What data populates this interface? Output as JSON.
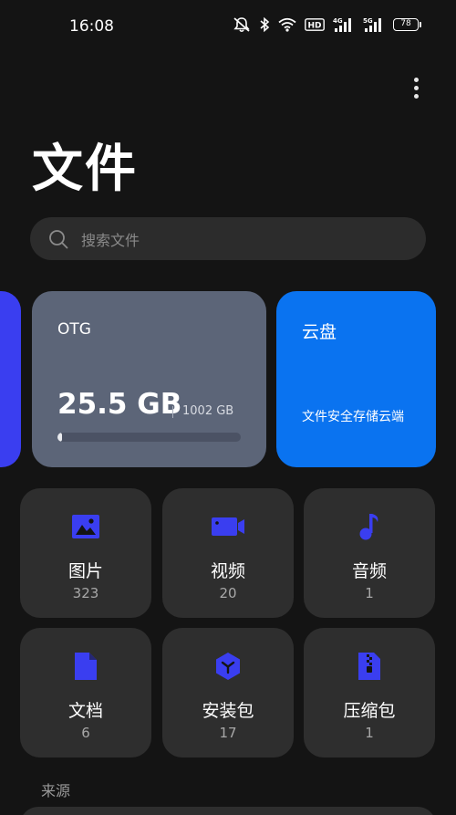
{
  "status_bar": {
    "time": "16:08",
    "net_4g": "4G",
    "net_5g": "5G",
    "hd_badge": "HD",
    "battery": "78"
  },
  "header": {
    "title": "文件",
    "more_icon": "more-vertical-icon"
  },
  "search": {
    "placeholder": "搜索文件"
  },
  "storage": {
    "otg": {
      "name": "OTG",
      "used": "25.5 GB",
      "total": "1002 GB",
      "used_fraction": 0.025
    },
    "cloud": {
      "name": "云盘",
      "description": "文件安全存储云端"
    }
  },
  "categories": [
    {
      "label": "图片",
      "count": "323",
      "icon": "image-icon"
    },
    {
      "label": "视频",
      "count": "20",
      "icon": "video-icon"
    },
    {
      "label": "音频",
      "count": "1",
      "icon": "music-note-icon"
    },
    {
      "label": "文档",
      "count": "6",
      "icon": "document-icon"
    },
    {
      "label": "安装包",
      "count": "17",
      "icon": "package-icon"
    },
    {
      "label": "压缩包",
      "count": "1",
      "icon": "zip-icon"
    }
  ],
  "sources": {
    "title": "来源"
  },
  "colors": {
    "accent": "#3a3ef0",
    "cloud": "#0a73f0",
    "otg_card": "#5c6578",
    "background": "#141414",
    "tile": "#2e2e2e"
  }
}
